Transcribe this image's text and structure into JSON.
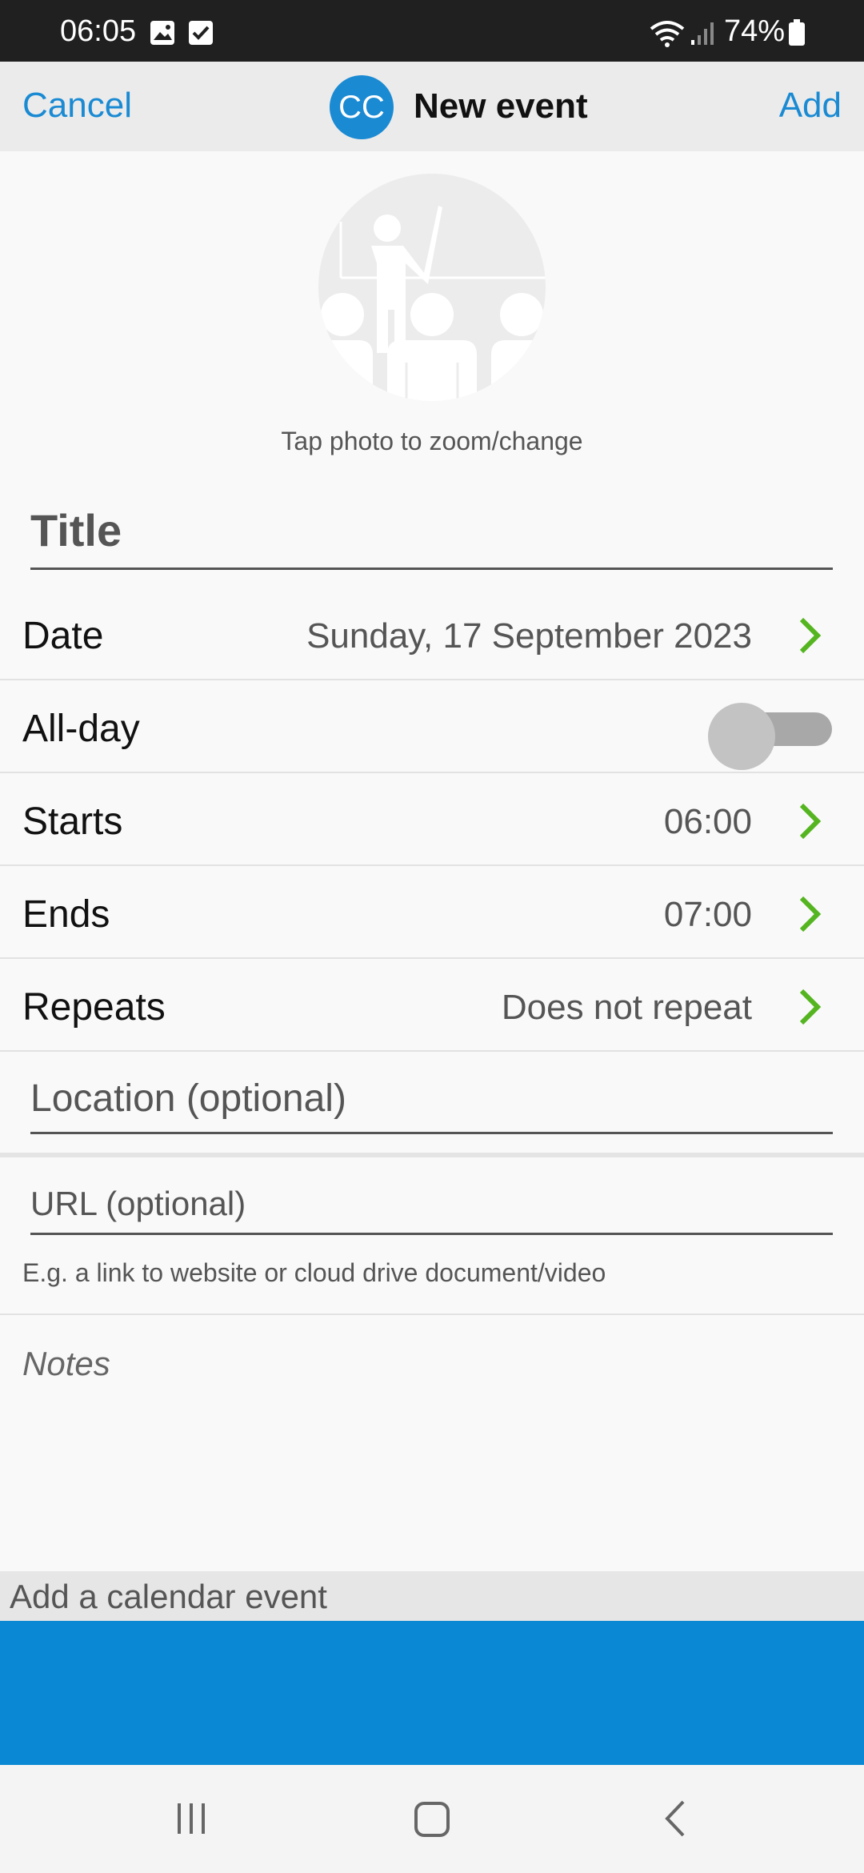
{
  "status_bar": {
    "time": "06:05",
    "battery": "74%",
    "icons": [
      "gallery-icon",
      "checkbox-icon",
      "wifi-icon",
      "signal-icon",
      "battery-icon"
    ]
  },
  "header": {
    "cancel_label": "Cancel",
    "logo_text": "CC",
    "title": "New event",
    "add_label": "Add",
    "accent_color": "#1a8ad3"
  },
  "photo": {
    "hint": "Tap photo to zoom/change",
    "icon": "presentation-classroom-icon"
  },
  "form": {
    "title_placeholder": "Title",
    "date": {
      "label": "Date",
      "value": "Sunday, 17 September 2023"
    },
    "all_day": {
      "label": "All-day",
      "on": false
    },
    "starts": {
      "label": "Starts",
      "value": "06:00"
    },
    "ends": {
      "label": "Ends",
      "value": "07:00"
    },
    "repeats": {
      "label": "Repeats",
      "value": "Does not repeat"
    },
    "location_placeholder": "Location (optional)",
    "url_placeholder": "URL (optional)",
    "url_hint": "E.g. a link to website or cloud drive document/video",
    "notes_placeholder": "Notes",
    "chevron_color": "#55b520"
  },
  "footer": {
    "banner_text": "Add a calendar event",
    "block_color": "#0a88d3"
  },
  "navbar": {
    "buttons": [
      "recent-apps-icon",
      "home-icon",
      "back-icon"
    ]
  }
}
